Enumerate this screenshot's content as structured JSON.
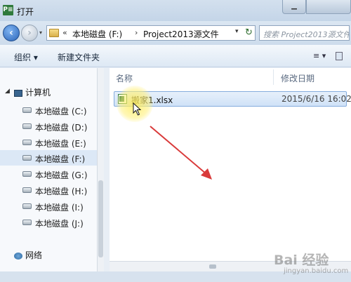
{
  "window": {
    "app_icon_text": "P≡",
    "title": "打开"
  },
  "navigation": {
    "breadcrumbs": [
      "«",
      "本地磁盘 (F:)",
      "›",
      "Project2013源文件",
      "▾"
    ],
    "search_placeholder": "搜索 Project2013源文件"
  },
  "toolbar": {
    "organize_label": "组织 ▾",
    "new_folder_label": "新建文件夹",
    "view_label": "≡ ▾"
  },
  "sidebar": {
    "computer_label": "计算机",
    "drives": [
      {
        "label": "本地磁盘 (C:)",
        "selected": false
      },
      {
        "label": "本地磁盘 (D:)",
        "selected": false
      },
      {
        "label": "本地磁盘 (E:)",
        "selected": false
      },
      {
        "label": "本地磁盘 (F:)",
        "selected": true
      },
      {
        "label": "本地磁盘 (G:)",
        "selected": false
      },
      {
        "label": "本地磁盘 (H:)",
        "selected": false
      },
      {
        "label": "本地磁盘 (I:)",
        "selected": false
      },
      {
        "label": "本地磁盘 (J:)",
        "selected": false
      }
    ],
    "network_label": "网络"
  },
  "file_list": {
    "columns": {
      "name": "名称",
      "modified": "修改日期"
    },
    "files": [
      {
        "name": "搬家1.xlsx",
        "modified": "2015/6/16 16:02",
        "selected": true
      }
    ]
  },
  "watermark": {
    "brand": "Bai 经验",
    "url": "jingyan.baidu.com"
  },
  "colors": {
    "accent": "#84acdd",
    "selection": "#cfe2f7",
    "annotation_arrow": "#d93a3a",
    "highlight": "#ffec5a"
  }
}
